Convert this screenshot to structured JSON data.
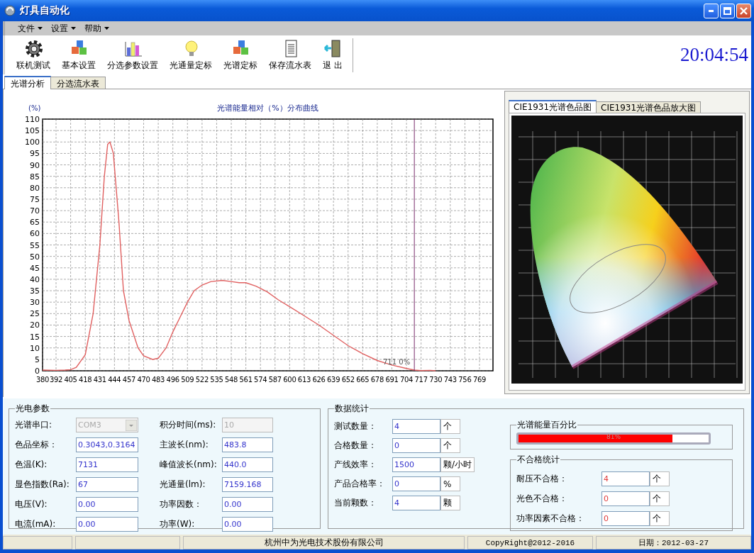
{
  "window": {
    "title": "灯具自动化"
  },
  "menu": [
    {
      "label": "文件"
    },
    {
      "label": "设置"
    },
    {
      "label": "帮助"
    }
  ],
  "toolbar": {
    "buttons": [
      {
        "label": "联机测试",
        "kind": "gear"
      },
      {
        "label": "基本设置",
        "kind": "cubes"
      },
      {
        "label": "分选参数设置",
        "kind": "bars"
      },
      {
        "label": "光通量定标",
        "kind": "bulb"
      },
      {
        "label": "光谱定标",
        "kind": "cubes"
      },
      {
        "label": "保存流水表",
        "kind": "document"
      },
      {
        "label": "退 出",
        "kind": "exit"
      }
    ],
    "clock": "20:04:54"
  },
  "tabs": [
    {
      "label": "光谱分析",
      "selected": true
    },
    {
      "label": "分选流水表",
      "selected": false
    }
  ],
  "spectrum": {
    "chart_data": {
      "type": "line",
      "title": "光谱能量相对（%）分布曲线",
      "ylabel": "(%)",
      "x": [
        380,
        392,
        400,
        405,
        410,
        418,
        425,
        431,
        435,
        438,
        440,
        443,
        448,
        452,
        457,
        465,
        470,
        478,
        483,
        490,
        496,
        503,
        509,
        515,
        522,
        530,
        540,
        548,
        555,
        561,
        570,
        580,
        590,
        600,
        613,
        626,
        639,
        652,
        665,
        678,
        691,
        704,
        711,
        717,
        725,
        730
      ],
      "series": [
        {
          "color": "#e06060",
          "values": [
            0.3,
            0.2,
            0.3,
            0.5,
            1.5,
            7,
            25,
            55,
            85,
            99,
            100,
            95,
            65,
            35,
            22,
            10,
            6.5,
            5,
            5.5,
            10,
            17,
            24,
            30,
            35,
            37.5,
            39,
            39.5,
            39,
            38.5,
            38.5,
            37,
            34.5,
            31,
            28,
            24,
            20,
            15.5,
            11,
            7.5,
            4.5,
            2.5,
            1,
            0.3,
            0.1,
            0.2,
            0
          ]
        }
      ],
      "xlim": [
        380,
        781
      ],
      "ylim": [
        0,
        110
      ],
      "xticks": [
        380,
        392,
        405,
        418,
        431,
        444,
        457,
        470,
        483,
        496,
        509,
        522,
        535,
        548,
        561,
        574,
        587,
        600,
        613,
        626,
        639,
        652,
        665,
        678,
        691,
        704,
        717,
        730,
        743,
        756,
        769
      ],
      "yticks": [
        0,
        5,
        10,
        15,
        20,
        25,
        30,
        35,
        40,
        45,
        50,
        55,
        60,
        65,
        70,
        75,
        80,
        85,
        90,
        95,
        100,
        105,
        110
      ],
      "grid": true,
      "ref_lines": [
        {
          "axis": "x",
          "value": 711,
          "label": "711 0%",
          "color": "#7a2a6a"
        }
      ]
    }
  },
  "diagram_tabs": [
    {
      "label": "CIE1931光谱色品图",
      "selected": true
    },
    {
      "label": "CIE1931光谱色品放大图",
      "selected": false
    }
  ],
  "photoelectric": {
    "title": "光电参数",
    "fields": [
      {
        "label": "光谱串口:",
        "value": "COM3",
        "kind": "combo",
        "disabled": true
      },
      {
        "label": "积分时间(ms):",
        "value": "10",
        "kind": "text",
        "disabled": true
      },
      {
        "label": "色品坐标：",
        "value": "0.3043,0.3164",
        "kind": "text",
        "disabled": false
      },
      {
        "label": "主波长(nm):",
        "value": "483.8",
        "kind": "text",
        "disabled": false
      },
      {
        "label": "色温(K):",
        "value": "7131",
        "kind": "text",
        "disabled": false
      },
      {
        "label": "峰值波长(nm):",
        "value": "440.0",
        "kind": "text",
        "disabled": false
      },
      {
        "label": "显色指数(Ra):",
        "value": "67",
        "kind": "text",
        "disabled": false
      },
      {
        "label": "光通量(lm):",
        "value": "7159.168",
        "kind": "text",
        "disabled": false
      },
      {
        "label": "电压(V):",
        "value": "0.00",
        "kind": "text",
        "disabled": false
      },
      {
        "label": "功率因数：",
        "value": "0.00",
        "kind": "text",
        "disabled": false
      },
      {
        "label": "电流(mA):",
        "value": "0.00",
        "kind": "text",
        "disabled": false
      },
      {
        "label": "功率(W):",
        "value": "0.00",
        "kind": "text",
        "disabled": false
      }
    ]
  },
  "statistics": {
    "title": "数据统计",
    "rows": [
      {
        "label": "测试数量：",
        "value": "4",
        "unit": "个"
      },
      {
        "label": "合格数量：",
        "value": "0",
        "unit": "个"
      },
      {
        "label": "产线效率：",
        "value": "1500",
        "unit": "颗/小时"
      },
      {
        "label": "产品合格率：",
        "value": "0",
        "unit": "%"
      },
      {
        "label": "当前颗数：",
        "value": "4",
        "unit": "颗"
      }
    ]
  },
  "energy": {
    "title": "光谱能量百分比",
    "level": 0.81,
    "reading": "81%"
  },
  "failures": {
    "title": "不合格统计",
    "rows": [
      {
        "label": "耐压不合格：",
        "value": "4",
        "unit": "个"
      },
      {
        "label": "光色不合格：",
        "value": "0",
        "unit": "个"
      },
      {
        "label": "功率因素不合格：",
        "value": "0",
        "unit": "个"
      }
    ]
  },
  "status_bar": {
    "company": "杭州中为光电技术股份有限公司",
    "copyright": "CopyRight@2012-2016",
    "date": "日期：2012-03-27"
  }
}
